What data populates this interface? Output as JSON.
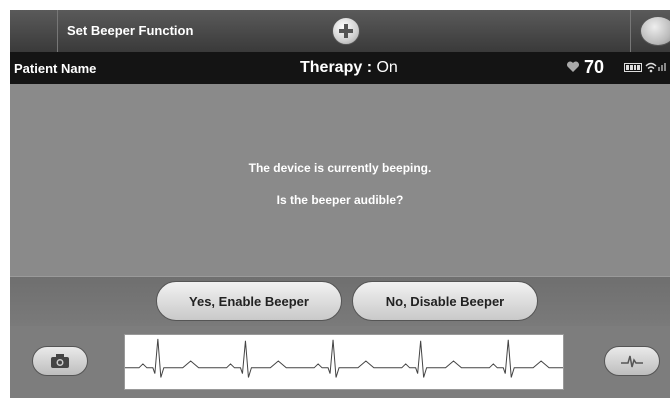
{
  "header": {
    "title": "Set Beeper Function"
  },
  "status": {
    "patient_label": "Patient Name",
    "therapy_label": "Therapy : ",
    "therapy_value": "On",
    "heart_rate": "70"
  },
  "dialog": {
    "line1": "The device is currently beeping.",
    "line2": "Is the beeper audible?"
  },
  "actions": {
    "yes_label": "Yes, Enable Beeper",
    "no_label": "No, Disable Beeper"
  },
  "icons": {
    "add": "plus-icon",
    "corner": "device-icon",
    "heart": "heart-icon",
    "battery": "battery-icon",
    "wireless": "wireless-icon",
    "signal": "signal-bars-icon",
    "camera": "camera-icon",
    "ecg": "ecg-icon"
  }
}
